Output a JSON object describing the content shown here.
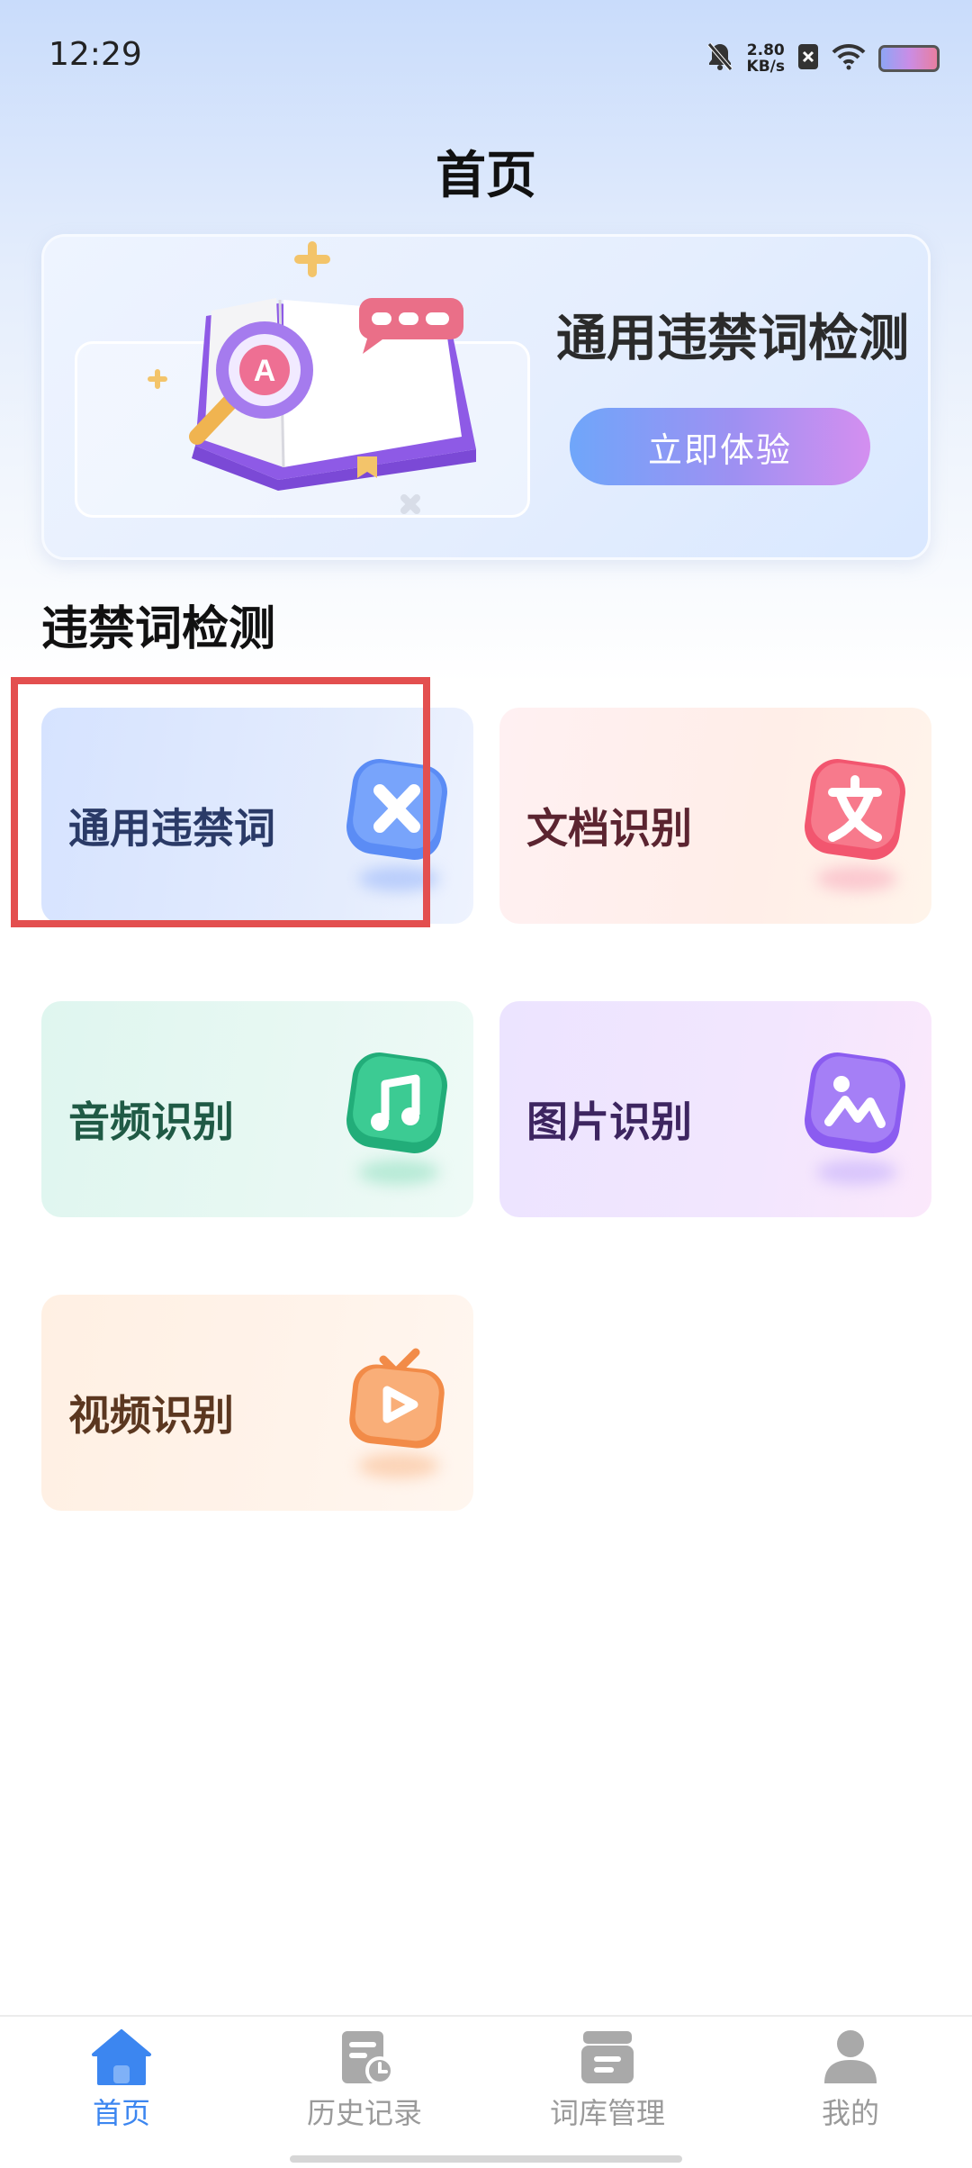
{
  "status_bar": {
    "time": "12:29",
    "net_speed_value": "2.80",
    "net_speed_unit": "KB/s"
  },
  "page": {
    "title": "首页"
  },
  "banner": {
    "title": "通用违禁词检测",
    "button_label": "立即体验"
  },
  "section": {
    "title": "违禁词检测"
  },
  "cards": [
    {
      "label": "通用违禁词",
      "icon": "close-x-icon",
      "color": "#5b8cf5"
    },
    {
      "label": "文档识别",
      "icon": "wen-character-icon",
      "color": "#f2566f"
    },
    {
      "label": "音频识别",
      "icon": "music-note-icon",
      "color": "#2fc08a"
    },
    {
      "label": "图片识别",
      "icon": "image-icon",
      "color": "#9a6cf2"
    },
    {
      "label": "视频识别",
      "icon": "tv-play-icon",
      "color": "#f59a5a"
    }
  ],
  "tabbar": {
    "items": [
      {
        "label": "首页",
        "icon": "home-icon",
        "active": true
      },
      {
        "label": "历史记录",
        "icon": "history-icon",
        "active": false
      },
      {
        "label": "词库管理",
        "icon": "library-icon",
        "active": false
      },
      {
        "label": "我的",
        "icon": "profile-icon",
        "active": false
      }
    ],
    "active_color": "#3c86f0",
    "inactive_color": "#9a9a9a"
  },
  "highlight_color": "#e34f4f"
}
